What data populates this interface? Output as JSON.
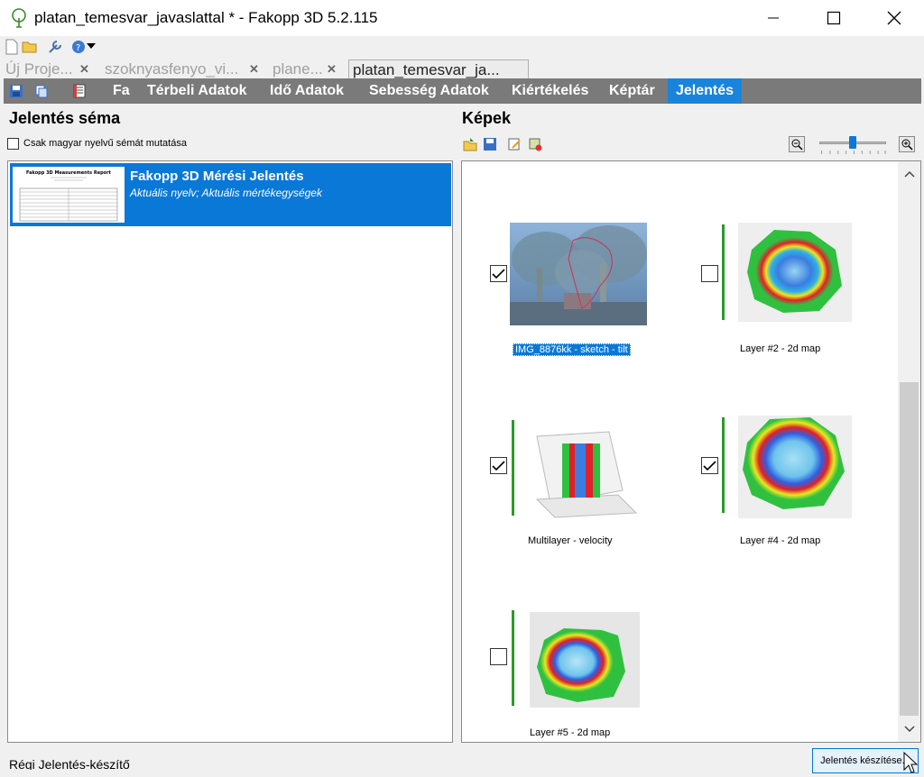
{
  "window": {
    "title": "platan_temesvar_javaslattal * - Fakopp 3D 5.2.115"
  },
  "doc_tabs": [
    {
      "label": "Új Proje..."
    },
    {
      "label": "szoknyasfenyo_vi..."
    },
    {
      "label": "plane..."
    },
    {
      "label": "platan_temesvar_ja..."
    }
  ],
  "menu": {
    "items": [
      {
        "label": "Fa"
      },
      {
        "label": "Térbeli Adatok"
      },
      {
        "label": "Idő Adatok"
      },
      {
        "label": "Sebesség Adatok"
      },
      {
        "label": "Kiértékelés"
      },
      {
        "label": "Képtár"
      },
      {
        "label": "Jelentés"
      }
    ],
    "active": "Jelentés"
  },
  "left": {
    "title": "Jelentés séma",
    "checkbox_label": "Csak magyar nyelvű sémát mutatása",
    "schema": {
      "title": "Fakopp 3D Mérési Jelentés",
      "subtitle": "Aktuális nyelv; Aktuális mértékegységek",
      "thumb_heading": "Fakopp 3D Measurements Report"
    }
  },
  "right": {
    "title": "Képek",
    "images": [
      {
        "caption": "IMG_8876kk - sketch - tilt",
        "checked": true,
        "selected": true,
        "kind": "photo"
      },
      {
        "caption": "Layer #2 - 2d map",
        "checked": false,
        "selected": false,
        "kind": "map"
      },
      {
        "caption": "Multilayer - velocity",
        "checked": true,
        "selected": false,
        "kind": "3d"
      },
      {
        "caption": "Layer #4 - 2d map",
        "checked": true,
        "selected": false,
        "kind": "map"
      },
      {
        "caption": "Layer #5 - 2d map",
        "checked": false,
        "selected": false,
        "kind": "map"
      }
    ]
  },
  "bottom": {
    "left_text": "Régi Jelentés-készítő",
    "create_button": "Jelentés készítése..."
  },
  "colors": {
    "accent": "#0a78d7",
    "menubar": "#7a7a7a"
  }
}
